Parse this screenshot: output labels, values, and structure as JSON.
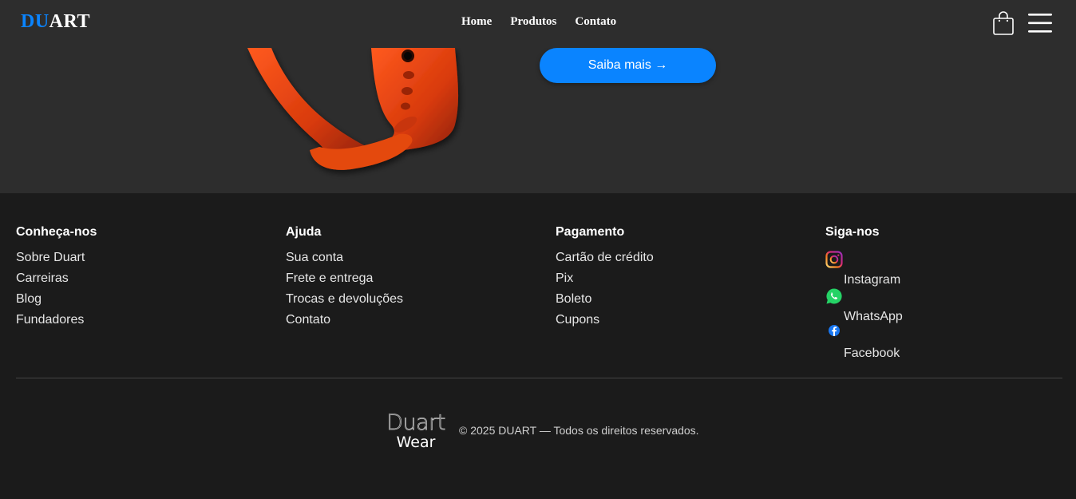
{
  "header": {
    "logo_part1": "DU",
    "logo_part2": "ART",
    "nav": [
      {
        "label": "Home"
      },
      {
        "label": "Produtos"
      },
      {
        "label": "Contato"
      }
    ],
    "icons": [
      "shopping-bag-icon",
      "hamburger-menu-icon"
    ]
  },
  "hero": {
    "cta_label": "Saiba mais →"
  },
  "footer": {
    "columns": [
      {
        "title": "Conheça-nos",
        "items": [
          "Sobre Duart",
          "Carreiras",
          "Blog",
          "Fundadores"
        ]
      },
      {
        "title": "Ajuda",
        "items": [
          "Sua conta",
          "Frete e entrega",
          "Trocas e devoluções",
          "Contato"
        ]
      },
      {
        "title": "Pagamento",
        "items": [
          "Cartão de crédito",
          "Pix",
          "Boleto",
          "Cupons"
        ]
      },
      {
        "title": "Siga-nos",
        "items": [
          {
            "label": "Instagram",
            "icon": "instagram-icon"
          },
          {
            "label": "WhatsApp",
            "icon": "whatsapp-icon"
          },
          {
            "label": "Facebook",
            "icon": "facebook-icon"
          }
        ]
      }
    ],
    "brand_line1": "Duart",
    "brand_line2": "Wear",
    "copyright": "© 2025 DUART — Todos os direitos reservados."
  },
  "colors": {
    "accent": "#0a84ff",
    "header_bg": "#2d2d2d",
    "footer_bg": "#1b1b1b",
    "strap": "#e0440f"
  }
}
